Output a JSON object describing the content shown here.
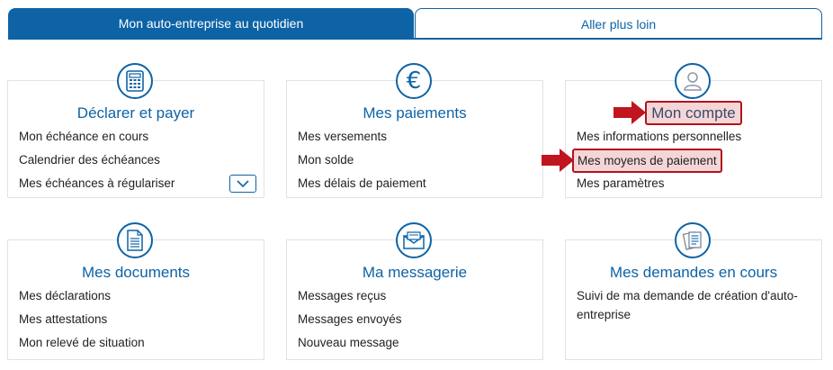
{
  "tabs": {
    "active": "Mon auto-entreprise au quotidien",
    "inactive": "Aller plus loin"
  },
  "cards": {
    "declarer": {
      "icon": "calculator-icon",
      "title": "Déclarer et payer",
      "links": [
        "Mon échéance en cours",
        "Calendrier des échéances",
        "Mes échéances à régulariser"
      ],
      "expand_icon": "chevron-down-icon"
    },
    "paiements": {
      "icon": "euro-icon",
      "title": "Mes paiements",
      "links": [
        "Mes versements",
        "Mon solde",
        "Mes délais de paiement"
      ]
    },
    "compte": {
      "icon": "user-icon",
      "title": "Mon compte",
      "links": [
        "Mes informations personnelles",
        "Mes moyens de paiement",
        "Mes paramètres"
      ]
    },
    "documents": {
      "icon": "document-icon",
      "title": "Mes documents",
      "links": [
        "Mes déclarations",
        "Mes attestations",
        "Mon relevé de situation"
      ]
    },
    "messagerie": {
      "icon": "envelope-icon",
      "title": "Ma messagerie",
      "links": [
        "Messages reçus",
        "Messages envoyés",
        "Nouveau message"
      ]
    },
    "demandes": {
      "icon": "documents-stack-icon",
      "title": "Mes demandes en cours",
      "links": [
        "Suivi de ma demande de création d'auto-entreprise"
      ]
    }
  },
  "annotations": {
    "highlight_color": "#b3121f",
    "arrow_icon": "red-arrow-icon"
  },
  "colors": {
    "brand": "#0d63a6",
    "highlight_fill": "#f5d6d6"
  }
}
